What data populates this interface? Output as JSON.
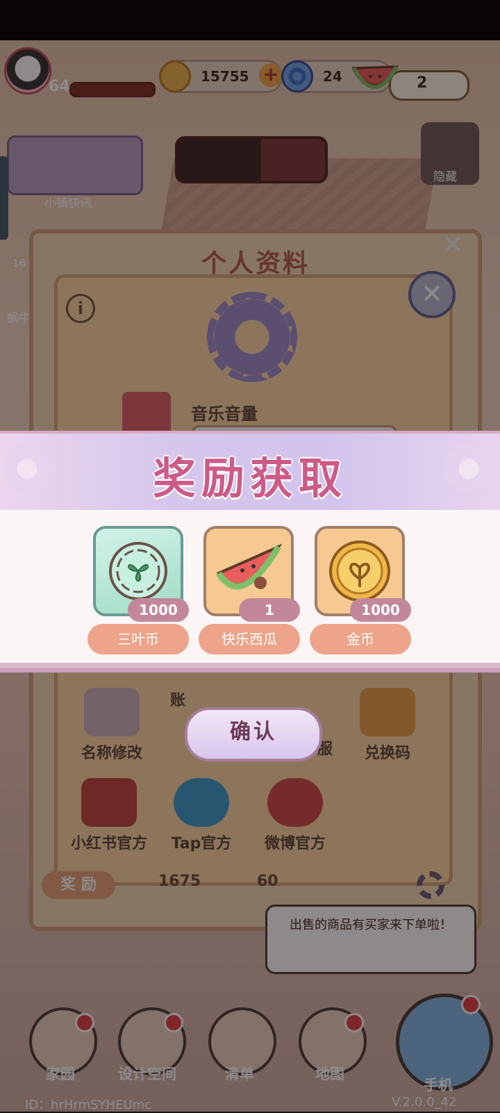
{
  "hud": {
    "level": "64",
    "coins": "15755",
    "gems": "24",
    "watermelon_count": "2"
  },
  "news_label": "小镇快讯",
  "hide_label": "隐藏",
  "side": {
    "text1": "16",
    "text2": "蜗牛"
  },
  "profile": {
    "title": "个人资料",
    "music_volume_label": "音乐音量",
    "menu": [
      {
        "label": "名称修改",
        "icon": "pencil-icon"
      },
      {
        "label": "账",
        "icon": "account-icon"
      },
      {
        "label": "服",
        "icon": "headset-icon"
      },
      {
        "label": "兑换码",
        "icon": "ticket-icon"
      },
      {
        "label": "小红书官方",
        "icon": "book-icon"
      },
      {
        "label": "Tap官方",
        "icon": "tap-icon"
      },
      {
        "label": "微博官方",
        "icon": "weibo-icon"
      }
    ],
    "reward_tab": "奖 励",
    "reward_coins": "1675",
    "reward_gems": "60"
  },
  "bubble": {
    "text": "出售的商品有买家来下单啦！"
  },
  "bottom_nav": [
    {
      "label": "家园",
      "icon": "home-icon"
    },
    {
      "label": "设计空间",
      "icon": "design-icon"
    },
    {
      "label": "清单",
      "icon": "list-icon"
    },
    {
      "label": "地图",
      "icon": "map-pin-icon"
    },
    {
      "label": "手机",
      "icon": "phone-icon"
    }
  ],
  "footer": {
    "id": "ID：hrHrmSYHEUmc",
    "version": "V.2.0.0_42"
  },
  "reward_modal": {
    "title": "奖励获取",
    "items": [
      {
        "name": "三叶币",
        "qty": "1000",
        "icon": "clover-coin-icon"
      },
      {
        "name": "快乐西瓜",
        "qty": "1",
        "icon": "watermelon-icon"
      },
      {
        "name": "金币",
        "qty": "1000",
        "icon": "gold-coin-icon"
      }
    ],
    "confirm_label": "确认"
  }
}
